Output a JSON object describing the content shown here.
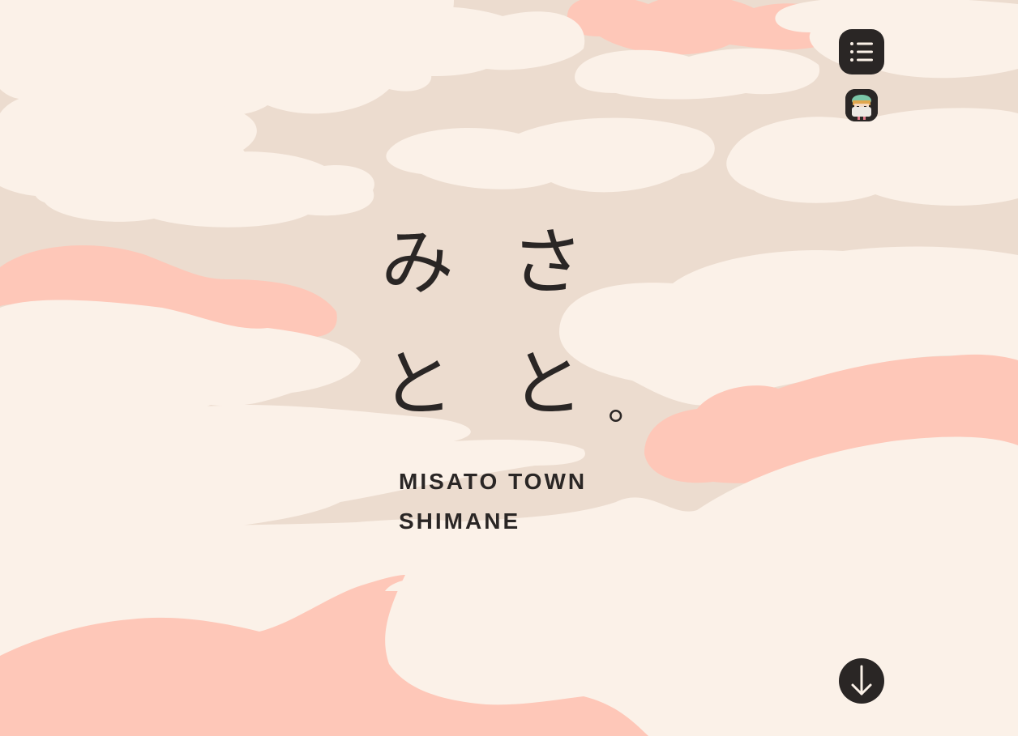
{
  "logo": {
    "kana_row1": [
      "み",
      "さ"
    ],
    "kana_row2": [
      "と",
      "と",
      "。"
    ],
    "subtitle_line1": "MISATO TOWN",
    "subtitle_line2": "SHIMANE"
  },
  "controls": {
    "menu_icon": "list-icon",
    "avatar": "mascot-avatar",
    "scroll_icon": "arrow-down-icon"
  },
  "colors": {
    "background": "#ecdccf",
    "cloud_cream": "#fbf1e8",
    "cloud_pink": "#fec7b8",
    "ink": "#2a2625"
  }
}
